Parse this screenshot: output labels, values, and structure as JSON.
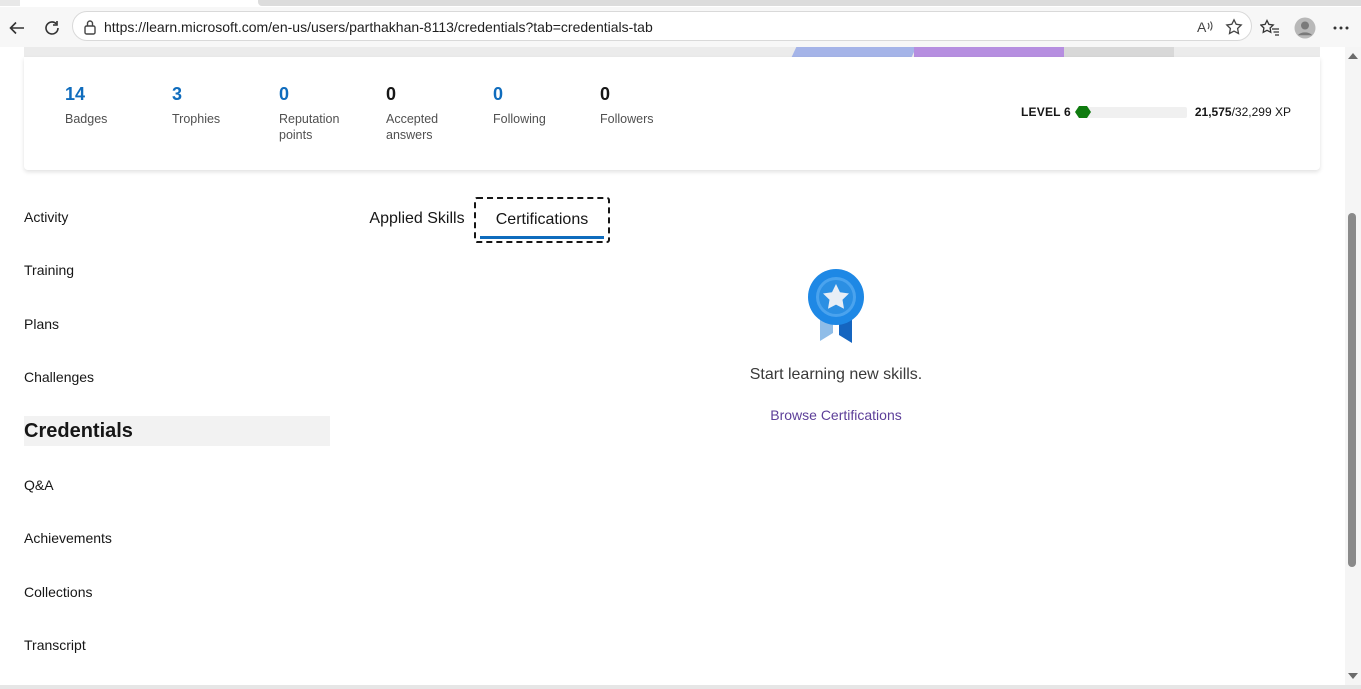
{
  "browser": {
    "url": "https://learn.microsoft.com/en-us/users/parthakhan-8113/credentials?tab=credentials-tab",
    "icons": [
      "back-icon",
      "refresh-icon",
      "lock-icon",
      "read-aloud-icon",
      "favorite-star-icon",
      "favorites-icon",
      "profile-icon",
      "more-icon"
    ]
  },
  "stats": [
    {
      "value": "14",
      "label": "Badges",
      "color": "#0f6cbd"
    },
    {
      "value": "3",
      "label": "Trophies",
      "color": "#0f6cbd"
    },
    {
      "value": "0",
      "label": "Reputation points",
      "color": "#0f6cbd"
    },
    {
      "value": "0",
      "label": "Accepted answers",
      "color": "#161616"
    },
    {
      "value": "0",
      "label": "Following",
      "color": "#0f6cbd"
    },
    {
      "value": "0",
      "label": "Followers",
      "color": "#161616"
    }
  ],
  "level": {
    "label": "LEVEL 6",
    "xp_current": "21,575",
    "xp_total": "/32,299 XP",
    "progress_fraction": 0.01,
    "bar_color": "#0f7b0f"
  },
  "sidebar": {
    "items": [
      {
        "label": "Activity"
      },
      {
        "label": "Training"
      },
      {
        "label": "Plans"
      },
      {
        "label": "Challenges"
      },
      {
        "label": "Credentials",
        "active": true
      },
      {
        "label": "Q&A"
      },
      {
        "label": "Achievements"
      },
      {
        "label": "Collections"
      },
      {
        "label": "Transcript"
      }
    ]
  },
  "tabs": {
    "applied": "Applied Skills",
    "certifications": "Certifications",
    "selected": "certifications"
  },
  "empty_state": {
    "icon": "certification-ribbon-icon",
    "message": "Start learning new skills.",
    "link": "Browse Certifications"
  },
  "colors": {
    "accent": "#0f6cbd",
    "link": "#5d3f99"
  }
}
